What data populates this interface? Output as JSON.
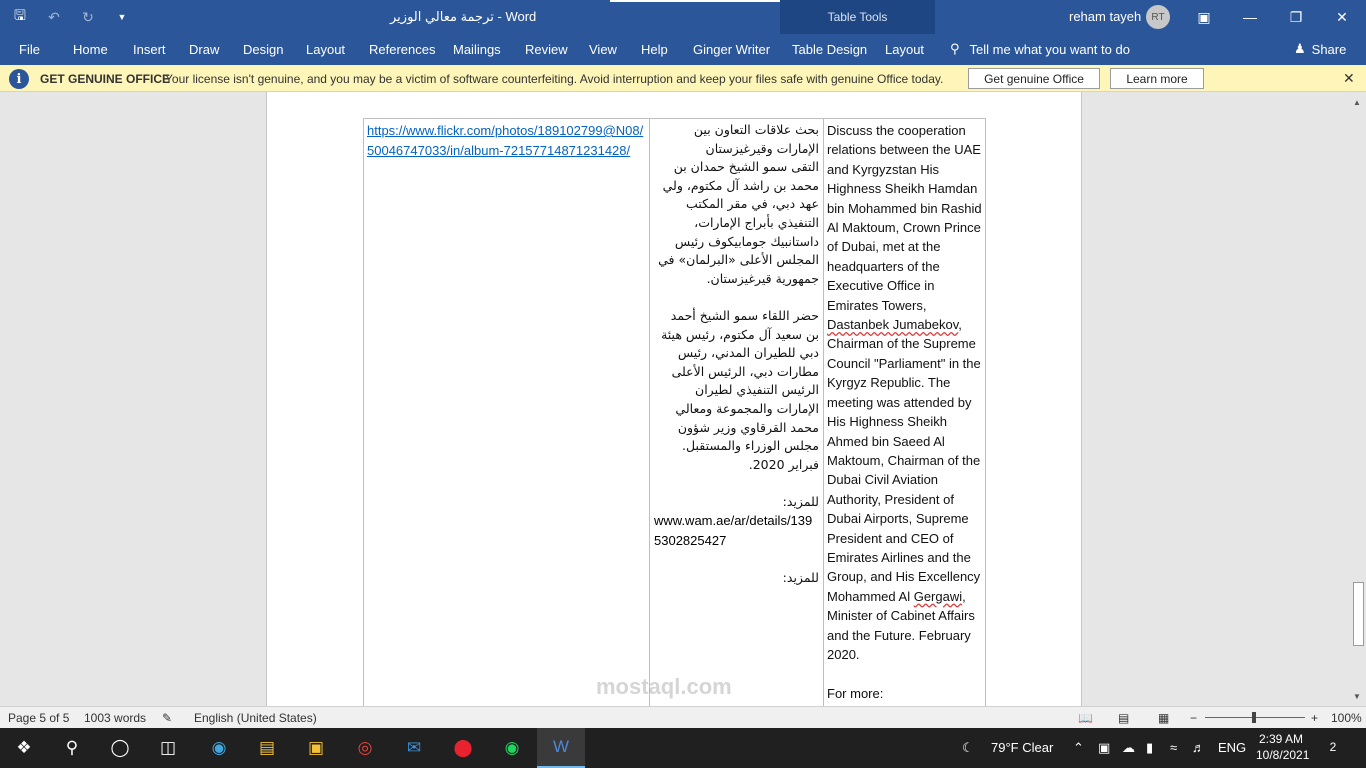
{
  "titlebar": {
    "doc_title": "ترجمة معالي الوزير  -  Word",
    "table_tools": "Table Tools",
    "user": "reham tayeh",
    "initials": "RT"
  },
  "ribbon": {
    "tabs": [
      "File",
      "Home",
      "Insert",
      "Draw",
      "Design",
      "Layout",
      "References",
      "Mailings",
      "Review",
      "View",
      "Help",
      "Ginger Writer",
      "Table Design",
      "Layout"
    ],
    "tell_me": "Tell me what you want to do",
    "share": "Share"
  },
  "message_bar": {
    "title": "GET GENUINE OFFICE",
    "text": "Your license isn't genuine, and you may be a victim of software counterfeiting. Avoid interruption and keep your files safe with genuine Office today.",
    "btn_primary": "Get genuine Office",
    "btn_secondary": "Learn more"
  },
  "document": {
    "link": "https://www.flickr.com/photos/189102799@N08/50046747033/in/album-72157714871231428/",
    "arabic_title": "بحث علاقات التعاون بين الإمارات وقيرغيزستان",
    "arabic_p1": "التقى سمو الشيخ حمدان بن محمد بن راشد آل مكتوم، ولي عهد دبي، في مقر المكتب التنفيذي بأبراج الإمارات، داستانبيك جومابيكوف رئيس المجلس الأعلى «البرلمان» في جمهورية قيرغيزستان.",
    "arabic_p2": "حضر اللقاء سمو الشيخ أحمد بن سعيد آل مكتوم، رئيس هيئة دبي للطيران المدني، رئيس مطارات دبي، الرئيس الأعلى الرئيس التنفيذي لطيران الإمارات والمجموعة ومعالي محمد القرقاوي وزير شؤون مجلس الوزراء والمستقبل. فبراير 2020.",
    "arabic_more1": "للمزيد:",
    "arabic_url": "www.wam.ae/ar/details/1395302825427",
    "arabic_more2": "للمزيد:",
    "en_a": "Discuss the cooperation relations between the UAE and Kyrgyzstan His Highness Sheikh Hamdan bin Mohammed bin Rashid Al Maktoum, Crown Prince of Dubai, met at the headquarters of the Executive Office in Emirates Towers, ",
    "en_name1": "Dastanbek Jumabekov",
    "en_b": ", Chairman of the Supreme Council \"Parliament\" in the Kyrgyz Republic. The meeting was attended by His Highness Sheikh Ahmed bin Saeed Al Maktoum, Chairman of the Dubai Civil Aviation Authority, President of Dubai Airports, Supreme President and CEO of Emirates Airlines and the Group, and His Excellency Mohammed Al ",
    "en_name2": "Gergawi",
    "en_c": ", Minister of Cabinet Affairs and the Future. February 2020.",
    "en_more": "For more:"
  },
  "status": {
    "page": "Page 5 of 5",
    "words": "1003 words",
    "language": "English (United States)",
    "zoom": "100%"
  },
  "watermark": "mostaql.com",
  "taskbar": {
    "weather": "79°F  Clear",
    "lang": "ENG",
    "time": "2:39 AM",
    "date": "10/8/2021",
    "notifications": "2"
  }
}
